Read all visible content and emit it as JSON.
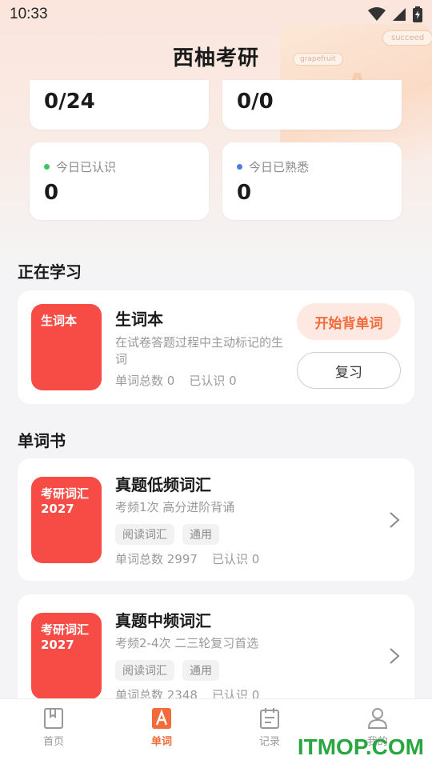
{
  "status": {
    "time": "10:33"
  },
  "header": {
    "title": "西柚考研"
  },
  "decor": {
    "tag1": "succeed",
    "tag2": "grapefruit"
  },
  "stats": {
    "top_left": {
      "value": "0/24"
    },
    "top_right": {
      "value": "0/0"
    },
    "known_today": {
      "label": "今日已认识",
      "value": "0",
      "dot_color": "#3cc860"
    },
    "familiar_today": {
      "label": "今日已熟悉",
      "value": "0",
      "dot_color": "#4a7de8"
    }
  },
  "learning": {
    "section_title": "正在学习",
    "cover_text": "生词本",
    "title": "生词本",
    "desc": "在试卷答题过程中主动标记的生词",
    "total_label": "单词总数 0",
    "known_label": "已认识 0",
    "start_button": "开始背单词",
    "review_button": "复习"
  },
  "wordbooks": {
    "section_title": "单词书",
    "items": [
      {
        "cover_text": "考研词汇2027",
        "title": "真题低频词汇",
        "desc": "考频1次 高分进阶背诵",
        "chips": [
          "阅读词汇",
          "通用"
        ],
        "total_label": "单词总数 2997",
        "known_label": "已认识 0"
      },
      {
        "cover_text": "考研词汇2027",
        "title": "真题中频词汇",
        "desc": "考频2-4次 二三轮复习首选",
        "chips": [
          "阅读词汇",
          "通用"
        ],
        "total_label": "单词总数 2348",
        "known_label": "已认识 0"
      }
    ]
  },
  "tabbar": {
    "items": [
      {
        "label": "首页",
        "icon": "book-icon"
      },
      {
        "label": "单词",
        "icon": "letter-a-icon"
      },
      {
        "label": "记录",
        "icon": "calendar-icon"
      },
      {
        "label": "我的",
        "icon": "user-icon"
      }
    ],
    "active_color": "#f26b3a"
  },
  "watermark": "ITMOP.COM"
}
